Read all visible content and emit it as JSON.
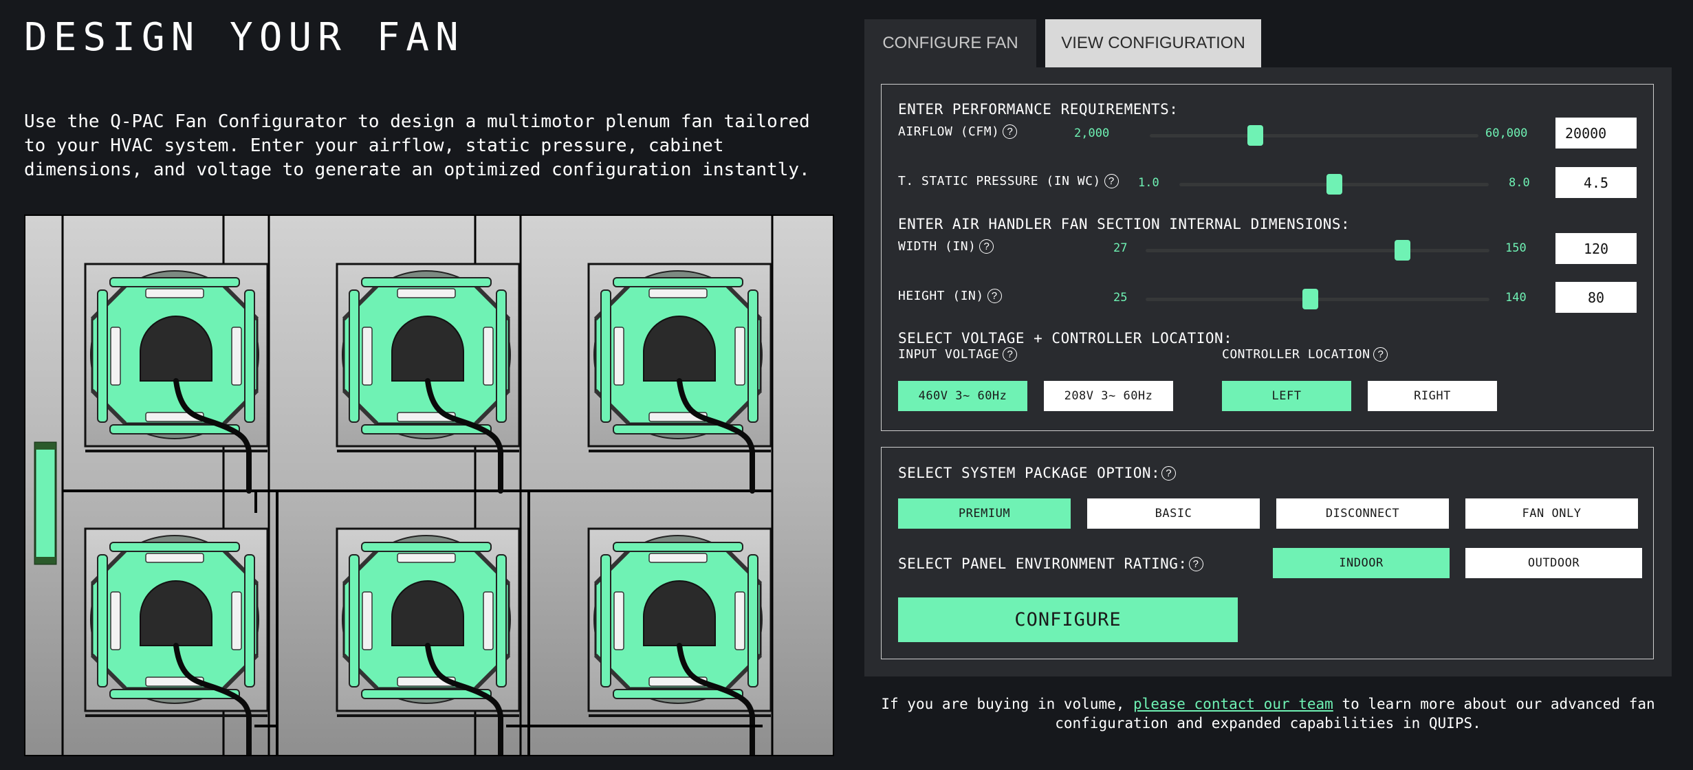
{
  "page": {
    "title": "DESIGN YOUR FAN",
    "intro": "Use the Q-PAC Fan Configurator to design a multimotor plenum fan tailored to your HVAC system. Enter your airflow, static pressure, cabinet dimensions, and voltage to generate an optimized configuration instantly."
  },
  "fan_image": {
    "rows": 2,
    "columns": 3,
    "accent_color": "#6ff2b4"
  },
  "tabs": [
    {
      "label": "CONFIGURE FAN",
      "active": true
    },
    {
      "label": "VIEW CONFIGURATION",
      "active": false
    }
  ],
  "performance": {
    "heading": "ENTER PERFORMANCE REQUIREMENTS:",
    "airflow": {
      "label": "AIRFLOW (CFM)",
      "min_label": "2,000",
      "max_label": "60,000",
      "min": 2000,
      "max": 60000,
      "value": "20000",
      "slider_fraction": 0.32
    },
    "static_pressure": {
      "label": "T. STATIC PRESSURE (IN WC)",
      "min_label": "1.0",
      "max_label": "8.0",
      "min": 1.0,
      "max": 8.0,
      "value": "4.5",
      "slider_fraction": 0.5
    }
  },
  "dimensions": {
    "heading": "ENTER AIR HANDLER FAN SECTION INTERNAL DIMENSIONS:",
    "width": {
      "label": "WIDTH (IN)",
      "min_label": "27",
      "max_label": "150",
      "min": 27,
      "max": 150,
      "value": "120",
      "slider_fraction": 0.745
    },
    "height": {
      "label": "HEIGHT (IN)",
      "min_label": "25",
      "max_label": "140",
      "min": 25,
      "max": 140,
      "value": "80",
      "slider_fraction": 0.478
    }
  },
  "voltage": {
    "heading": "SELECT VOLTAGE + CONTROLLER LOCATION:",
    "input_voltage_label": "INPUT VOLTAGE",
    "voltage_options": [
      {
        "label": "460V 3~ 60Hz",
        "selected": true
      },
      {
        "label": "208V 3~ 60Hz",
        "selected": false
      }
    ],
    "controller_label": "CONTROLLER LOCATION",
    "controller_options": [
      {
        "label": "LEFT",
        "selected": true
      },
      {
        "label": "RIGHT",
        "selected": false
      }
    ]
  },
  "package": {
    "heading": "SELECT SYSTEM PACKAGE OPTION:",
    "options": [
      {
        "label": "PREMIUM",
        "selected": true
      },
      {
        "label": "BASIC",
        "selected": false
      },
      {
        "label": "DISCONNECT",
        "selected": false
      },
      {
        "label": "FAN ONLY",
        "selected": false
      }
    ]
  },
  "environment": {
    "heading": "SELECT PANEL ENVIRONMENT RATING:",
    "options": [
      {
        "label": "INDOOR",
        "selected": true
      },
      {
        "label": "OUTDOOR",
        "selected": false
      }
    ]
  },
  "configure_button": "CONFIGURE",
  "footer": {
    "text_before": "If you are buying in volume, ",
    "link": "please contact our team",
    "text_after": " to learn more about our advanced fan configuration and expanded capabilities in QUIPS."
  },
  "colors": {
    "background": "#16181c",
    "panel": "#292b2f",
    "accent": "#6ff2b4",
    "tab_inactive": "#d9d9d9"
  }
}
